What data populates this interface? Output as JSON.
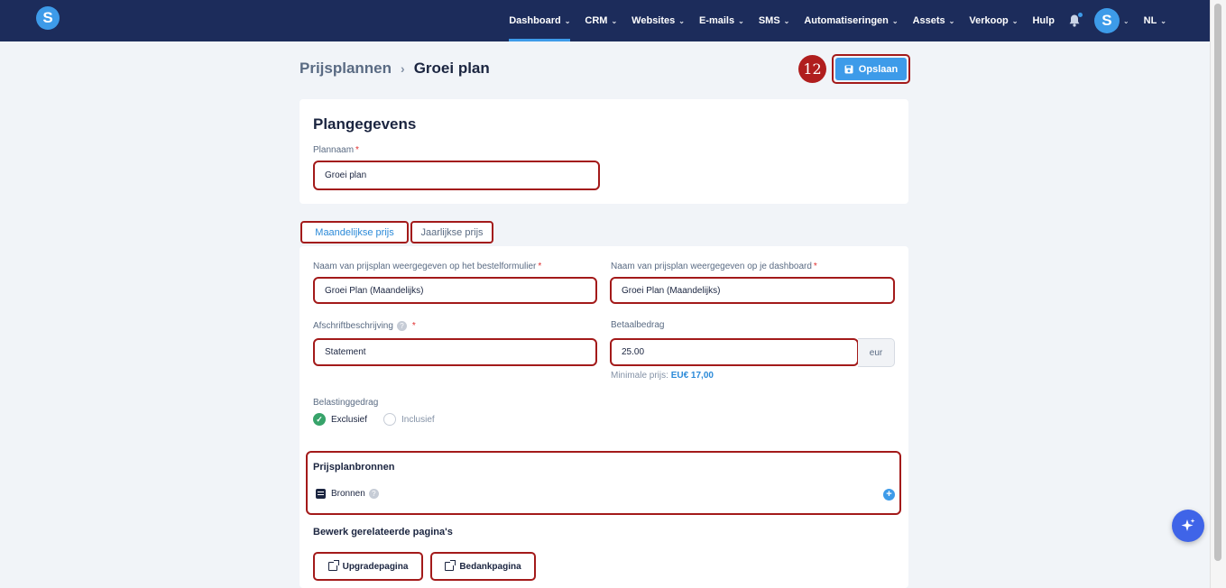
{
  "nav": {
    "logo_letter": "S",
    "items": [
      {
        "label": "Dashboard",
        "active": true
      },
      {
        "label": "CRM",
        "active": false
      },
      {
        "label": "Websites",
        "active": false
      },
      {
        "label": "E-mails",
        "active": false
      },
      {
        "label": "SMS",
        "active": false
      },
      {
        "label": "Automatiseringen",
        "active": false
      },
      {
        "label": "Assets",
        "active": false
      },
      {
        "label": "Verkoop",
        "active": false
      }
    ],
    "help_label": "Hulp",
    "avatar_letter": "S",
    "language": "NL"
  },
  "header": {
    "breadcrumb_parent": "Prijsplannen",
    "breadcrumb_current": "Groei plan",
    "step_number": "12",
    "save_label": "Opslaan"
  },
  "plan_details": {
    "title": "Plangegevens",
    "name_label": "Plannaam",
    "name_value": "Groei plan"
  },
  "tabs": {
    "monthly": "Maandelijkse prijs",
    "yearly": "Jaarlijkse prijs"
  },
  "pricing": {
    "order_form_name_label": "Naam van prijsplan weergegeven op het bestelformulier",
    "order_form_name_value": "Groei Plan (Maandelijks)",
    "dashboard_name_label": "Naam van prijsplan weergegeven op je dashboard",
    "dashboard_name_value": "Groei Plan (Maandelijks)",
    "statement_label": "Afschriftbeschrijving",
    "statement_value": "Statement",
    "amount_label": "Betaalbedrag",
    "amount_value": "25.00",
    "currency": "eur",
    "min_price_label": "Minimale prijs:",
    "min_price_value": "EU€ 17,00",
    "tax_label": "Belastinggedrag",
    "tax_options": [
      {
        "label": "Exclusief",
        "checked": true
      },
      {
        "label": "Inclusief",
        "checked": false
      }
    ]
  },
  "resources": {
    "title": "Prijsplanbronnen",
    "item_label": "Bronnen"
  },
  "related_pages": {
    "title": "Bewerk gerelateerde pagina's",
    "upgrade_label": "Upgradepagina",
    "thanks_label": "Bedankpagina"
  },
  "colors": {
    "nav_bg": "#1c2c5b",
    "accent": "#3d9be9",
    "highlight": "#a31a1a",
    "check": "#37a36a"
  }
}
